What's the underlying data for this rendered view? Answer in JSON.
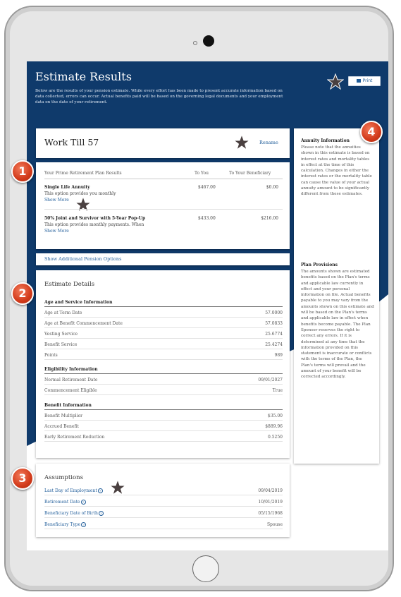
{
  "header": {
    "title": "Estimate Results",
    "subtitle": "Below are the results of your pension estimate. While every effort has been made to present accurate information based on data collected, errors can occur. Actual benefits paid will be based on the governing legal documents and your employment data on the date of your retirement.",
    "print_label": "Print"
  },
  "scenario": {
    "title": "Work Till 57",
    "rename_label": "Rename"
  },
  "results_table": {
    "col_plan": "Your Prime Retirement Plan Results",
    "col_you": "To You",
    "col_beneficiary": "To Your Beneficiary",
    "options": [
      {
        "name": "Single Life Annuity",
        "description": "This option provides you monthly",
        "more": "Show More",
        "to_you": "$467.00",
        "to_beneficiary": "$0.00"
      },
      {
        "name": "50% Joint and Survivor with 5-Year Pop-Up",
        "description": "This option provides monthly payments. When",
        "more": "Show More",
        "to_you": "$433.00",
        "to_beneficiary": "$216.00"
      }
    ]
  },
  "show_additional": "Show Additional Pension Options",
  "details": {
    "title": "Estimate Details",
    "age_service": {
      "heading": "Age and Service Information",
      "rows": [
        {
          "label": "Age at Term Date",
          "value": "57.0000"
        },
        {
          "label": "Age at Benefit Commencement Date",
          "value": "57.0833"
        },
        {
          "label": "Vesting Service",
          "value": "25.6774"
        },
        {
          "label": "Benefit Service",
          "value": "25.4274"
        },
        {
          "label": "Points",
          "value": "989"
        }
      ]
    },
    "eligibility": {
      "heading": "Eligibility Information",
      "rows": [
        {
          "label": "Normal Retirement Date",
          "value": "09/01/2027"
        },
        {
          "label": "Commencement Eligible",
          "value": "True"
        }
      ]
    },
    "benefit": {
      "heading": "Benefit Information",
      "rows": [
        {
          "label": "Benefit Multiplier",
          "value": "$35.00"
        },
        {
          "label": "Accrued Benefit",
          "value": "$889.96"
        },
        {
          "label": "Early Retirement Reduction",
          "value": "0.5250"
        }
      ]
    }
  },
  "assumptions": {
    "title": "Assumptions",
    "help_glyph": "?",
    "rows": [
      {
        "label": "Last Day of Employment",
        "value": "09/04/2019"
      },
      {
        "label": "Retirement Date",
        "value": "10/01/2019"
      },
      {
        "label": "Beneficiary Date of Birth",
        "value": "05/15/1968"
      },
      {
        "label": "Beneficiary Type",
        "value": "Spouse"
      }
    ]
  },
  "sidebar": {
    "annuity_heading": "Annuity Information",
    "annuity_text": "Please note that the annuities shown in this estimate is based on interest rates and mortality tables in effect at the time of this calculation. Changes in either the interest rates or the mortality table can cause the value of your actual annuity amount to be significantly different from these estimates.",
    "provisions_heading": "Plan Provisions",
    "provisions_text": "The amounts shown are estimated benefits based on the Plan's terms and applicable law currently in effect and your personal information on file. Actual benefits payable to you may vary from the amounts shown on this estimate and will be based on the Plan's terms and applicable law in effect when benefits become payable. The Plan Sponsor reserves the right to correct any errors. If it is determined at any time that the information provided on this statement is inaccurate or conflicts with the terms of the Plan, the Plan's terms will prevail and the amount of your benefit will be corrected accordingly."
  },
  "callouts": [
    "1",
    "2",
    "3",
    "4"
  ],
  "colors": {
    "navy": "#0f3a6b",
    "link": "#1f5c99",
    "badge": "#d23a1a",
    "star": "#4a4040"
  }
}
